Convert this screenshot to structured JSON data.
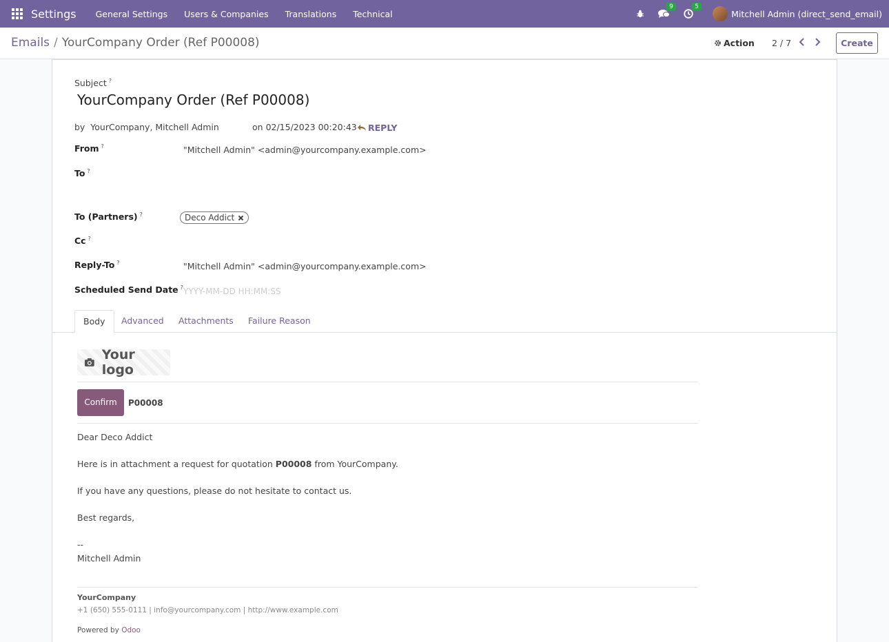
{
  "navbar": {
    "app_name": "Settings",
    "menu": [
      "General Settings",
      "Users & Companies",
      "Translations",
      "Technical"
    ],
    "messages_count": "9",
    "activities_count": "5",
    "user": "Mitchell Admin (direct_send_email)"
  },
  "control": {
    "breadcrumb_parent": "Emails",
    "breadcrumb_sep": "/",
    "breadcrumb_current": "YourCompany Order (Ref P00008)",
    "action_label": "Action",
    "pager": "2 / 7",
    "create_label": "Create"
  },
  "form": {
    "subject_label": "Subject",
    "subject": "YourCompany Order (Ref P00008)",
    "by_prefix": "by",
    "by_value": "YourCompany, Mitchell Admin",
    "on_prefix": "on",
    "date": "02/15/2023 00:20:43",
    "reply_label": "REPLY",
    "from_label": "From",
    "from_value": "\"Mitchell Admin\" <admin@yourcompany.example.com>",
    "to_label": "To",
    "to_partners_label": "To (Partners)",
    "partner_tag": "Deco Addict",
    "cc_label": "Cc",
    "reply_to_label": "Reply-To",
    "reply_to_value": "\"Mitchell Admin\" <admin@yourcompany.example.com>",
    "scheduled_label": "Scheduled Send Date",
    "scheduled_placeholder": "YYYY-MM-DD HH:MM:SS",
    "help_mark": "?"
  },
  "tabs": [
    "Body",
    "Advanced",
    "Attachments",
    "Failure Reason"
  ],
  "email_body": {
    "logo_text": "Your logo",
    "confirm_label": "Confirm",
    "reference": "P00008",
    "greeting": "Dear Deco Addict",
    "line1_pre": "Here is in attachment a request for quotation ",
    "line1_ref": "P00008",
    "line1_post": " from YourCompany.",
    "line2": "If you have any questions, please do not hesitate to contact us.",
    "line3": "Best regards,",
    "sig_dash": "--",
    "sig_name": "Mitchell Admin",
    "footer_company": "YourCompany",
    "footer_contact": "+1 (650) 555-0111 | info@yourcompany.com | http://www.example.com",
    "powered_by": "Powered by ",
    "odoo": "Odoo"
  }
}
